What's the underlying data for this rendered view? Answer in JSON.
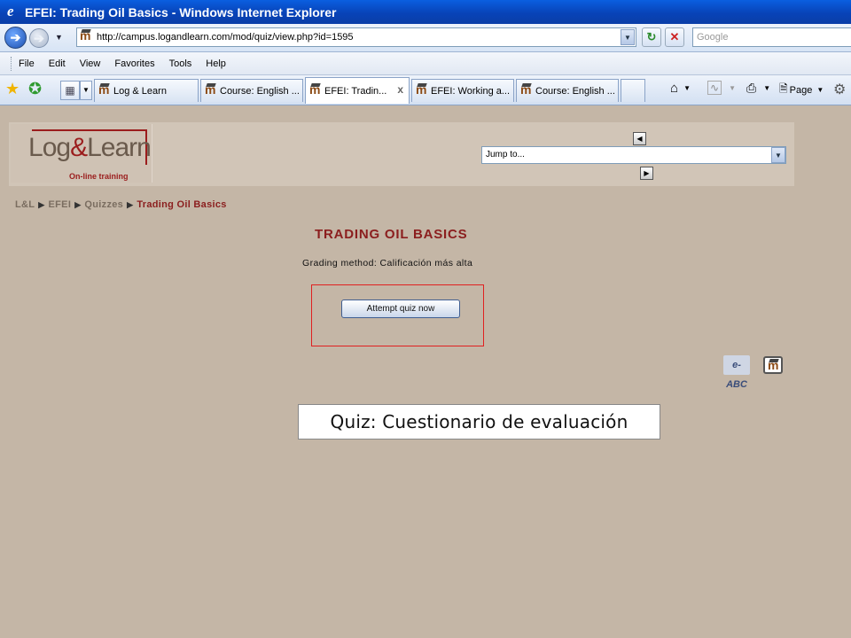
{
  "window": {
    "title": "EFEI: Trading Oil Basics - Windows Internet Explorer",
    "ie_icon": "ie-logo-icon"
  },
  "address_bar": {
    "url": "http://campus.logandlearn.com/mod/quiz/view.php?id=1595",
    "search_placeholder": "Google"
  },
  "menu": {
    "items": [
      "File",
      "Edit",
      "View",
      "Favorites",
      "Tools",
      "Help"
    ]
  },
  "tabs": [
    {
      "label": "Log & Learn",
      "active": false
    },
    {
      "label": "Course: English ...",
      "active": false
    },
    {
      "label": "EFEI: Tradin...",
      "active": true
    },
    {
      "label": "EFEI: Working a...",
      "active": false
    },
    {
      "label": "Course: English ...",
      "active": false
    },
    {
      "label": "",
      "active": false
    }
  ],
  "toolbar_right": {
    "page_label": "Page"
  },
  "site": {
    "logo_main_left": "og",
    "logo_amp": "&",
    "logo_main_right": "earn",
    "logo_sub": "On-line training",
    "jump_to": "Jump to..."
  },
  "breadcrumb": {
    "items": [
      "L&L",
      "EFEI",
      "Quizzes"
    ],
    "current": "Trading Oil Basics"
  },
  "quiz": {
    "title": "TRADING OIL BASICS",
    "grading_method": "Grading method: Calificación más alta",
    "attempt_button": "Attempt quiz now"
  },
  "footer_icons": {
    "eabc_label": "e-ABC"
  },
  "caption": "Quiz: Cuestionario de evaluación",
  "colors": {
    "page_bg": "#c4b6a6",
    "accent_red": "#8b1e1e",
    "highlight_box": "#e02020"
  }
}
